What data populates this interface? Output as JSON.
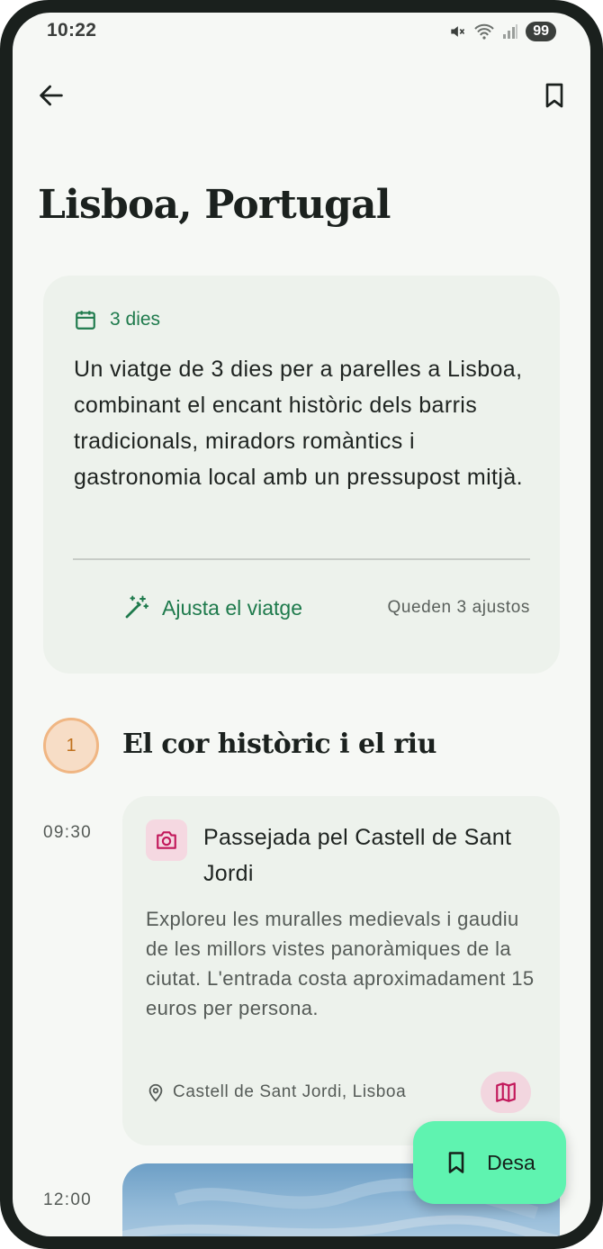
{
  "status_bar": {
    "time": "10:22",
    "battery": "99"
  },
  "top_bar": {
    "back_icon": "arrow-left-icon",
    "bookmark_icon": "bookmark-icon"
  },
  "page": {
    "title": "Lisboa, Portugal"
  },
  "summary": {
    "duration": "3 dies",
    "description": "Un viatge de 3 dies per a parelles a Lisboa, combinant el encant històric dels barris tradicionals, miradors romàntics i gastronomia local amb un pressupost mitjà.",
    "adjust_label": "Ajusta el viatge",
    "remaining": "Queden 3 ajustos"
  },
  "day": {
    "number": "1",
    "title": "El cor històric i el riu"
  },
  "activities": [
    {
      "time": "09:30",
      "title": "Passejada pel Castell de Sant Jordi",
      "description": "Exploreu les muralles medievals i gaudiu de les millors vistes panoràmiques de la ciutat. L'entrada costa aproximadament 15 euros per persona.",
      "location": "Castell de Sant Jordi, Lisboa",
      "icon": "camera-icon"
    },
    {
      "time": "12:00"
    }
  ],
  "fab": {
    "label": "Desa"
  },
  "colors": {
    "accent": "#1e7a4c",
    "fab": "#5ff3b0",
    "day_badge": "#f7ddc6",
    "activity_icon_bg": "#f5d8e1"
  }
}
